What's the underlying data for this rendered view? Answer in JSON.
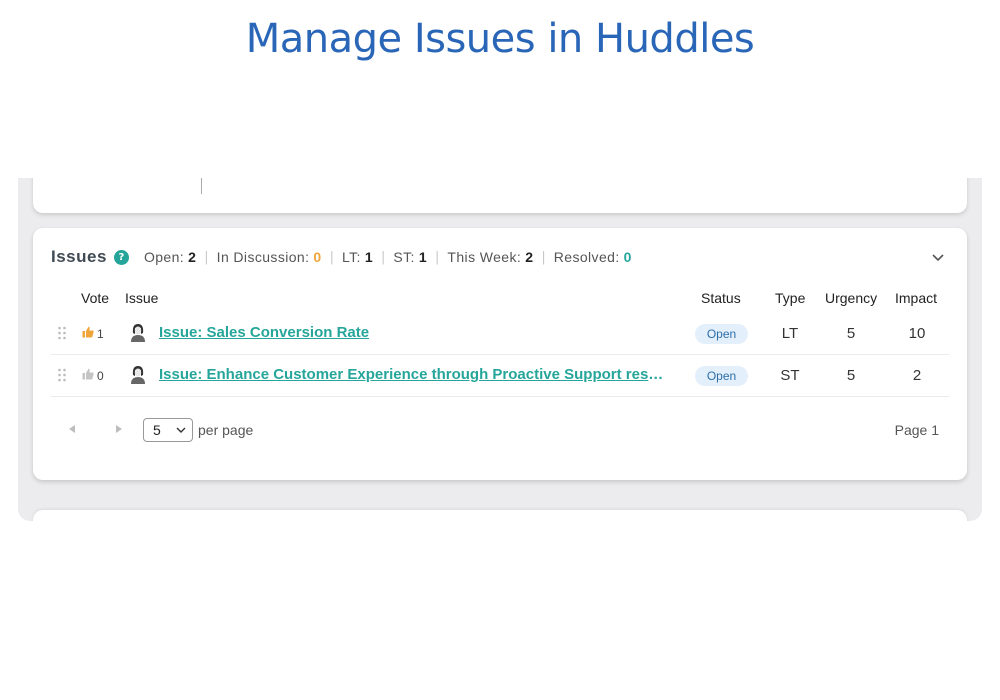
{
  "headline": "Manage Issues in Huddles",
  "panel": {
    "title": "Issues",
    "stats": [
      {
        "label": "Open:",
        "value": "2"
      },
      {
        "label": "In Discussion:",
        "value": "0"
      },
      {
        "label": "LT:",
        "value": "1"
      },
      {
        "label": "ST:",
        "value": "1"
      },
      {
        "label": "This Week:",
        "value": "2"
      },
      {
        "label": "Resolved:",
        "value": "0"
      }
    ],
    "columns": {
      "vote": "Vote",
      "issue": "Issue",
      "status": "Status",
      "type": "Type",
      "urgency": "Urgency",
      "impact": "Impact"
    },
    "rows": [
      {
        "votes": "1",
        "title": "Issue: Sales Conversion Rate",
        "status": "Open",
        "type": "LT",
        "urgency": "5",
        "impact": "10"
      },
      {
        "votes": "0",
        "title": "Issue: Enhance Customer Experience through Proactive Support resulting in Higher Retention",
        "status": "Open",
        "type": "ST",
        "urgency": "5",
        "impact": "2"
      }
    ],
    "pagination": {
      "per_page_value": "5",
      "per_page_label": "per page",
      "page_label": "Page 1"
    }
  },
  "colors": {
    "headline": "#2a66b8",
    "accent": "#26a69a",
    "discussion": "#f0a53a",
    "badge_bg": "#e3f0fb"
  },
  "icons": [
    "help-icon",
    "chevron-down-icon",
    "drag-handle-icon",
    "thumbs-up-icon",
    "avatar",
    "prev-page-icon",
    "next-page-icon"
  ]
}
